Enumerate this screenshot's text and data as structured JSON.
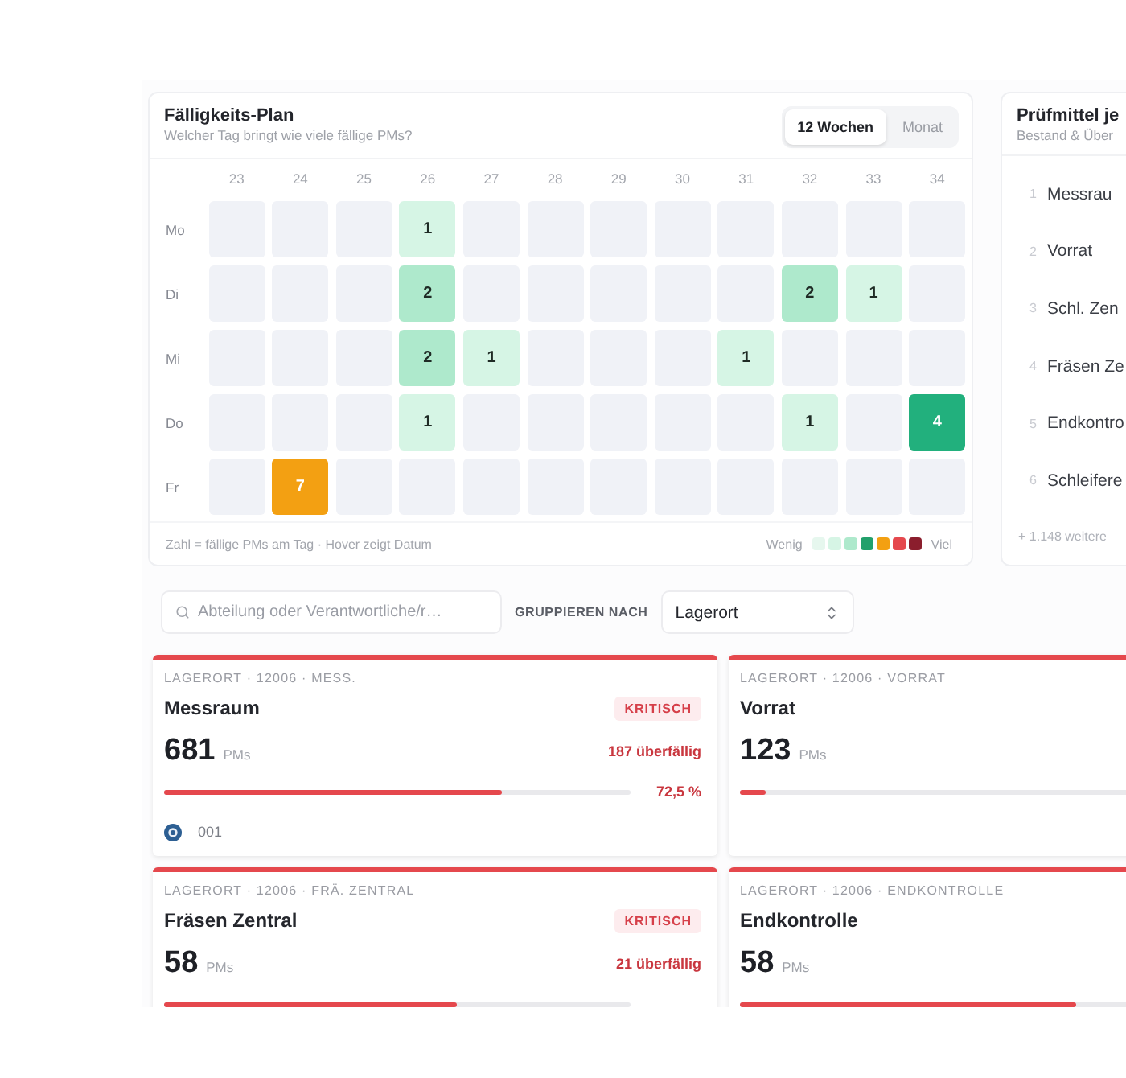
{
  "due_plan": {
    "title": "Fälligkeits-Plan",
    "subtitle": "Welcher Tag bringt wie viele fällige PMs?",
    "range_tabs": [
      {
        "label": "12 Wochen",
        "selected": true
      },
      {
        "label": "Monat",
        "selected": false
      }
    ],
    "weeks": [
      "23",
      "24",
      "25",
      "26",
      "27",
      "28",
      "29",
      "30",
      "31",
      "32",
      "33",
      "34"
    ],
    "rows": [
      {
        "day": "Mo",
        "cells": [
          null,
          null,
          null,
          {
            "count": "1",
            "color": "#d6f5e5"
          },
          null,
          null,
          null,
          null,
          null,
          null,
          null,
          null
        ]
      },
      {
        "day": "Di",
        "cells": [
          null,
          null,
          null,
          {
            "count": "2",
            "color": "#aee9cc"
          },
          null,
          null,
          null,
          null,
          null,
          {
            "count": "2",
            "color": "#aee9cc"
          },
          {
            "count": "1",
            "color": "#d6f5e5"
          },
          null
        ]
      },
      {
        "day": "Mi",
        "cells": [
          null,
          null,
          null,
          {
            "count": "2",
            "color": "#aee9cc"
          },
          {
            "count": "1",
            "color": "#d6f5e5"
          },
          null,
          null,
          null,
          {
            "count": "1",
            "color": "#d6f5e5"
          },
          null,
          null,
          null
        ]
      },
      {
        "day": "Do",
        "cells": [
          null,
          null,
          null,
          {
            "count": "1",
            "color": "#d6f5e5"
          },
          null,
          null,
          null,
          null,
          null,
          {
            "count": "1",
            "color": "#d6f5e5"
          },
          null,
          {
            "count": "4",
            "color": "#22b07d"
          }
        ]
      },
      {
        "day": "Fr",
        "cells": [
          null,
          {
            "count": "7",
            "color": "#f3a012"
          },
          null,
          null,
          null,
          null,
          null,
          null,
          null,
          null,
          null,
          null
        ]
      }
    ],
    "footnote": "Zahl = fällige PMs am Tag · Hover zeigt Datum",
    "legend": {
      "low": "Wenig",
      "high": "Viel",
      "swatches": [
        {
          "color": "#e6f7ee"
        },
        {
          "color": "#d6f5e5"
        },
        {
          "color": "#aee9cc"
        },
        {
          "color": "#22a06b"
        },
        {
          "color": "#f3a012"
        },
        {
          "color": "#e5484d"
        },
        {
          "color": "#8b1e2d"
        }
      ]
    }
  },
  "ranking_panel": {
    "title": "Prüfmittel je",
    "subtitle": "Bestand & Über",
    "items": [
      {
        "rank": "1",
        "name": "Messrau"
      },
      {
        "rank": "2",
        "name": "Vorrat"
      },
      {
        "rank": "3",
        "name": "Schl. Zen"
      },
      {
        "rank": "4",
        "name": "Fräsen Ze"
      },
      {
        "rank": "5",
        "name": "Endkontro"
      },
      {
        "rank": "6",
        "name": "Schleifere"
      }
    ],
    "more": "+ 1.148 weitere"
  },
  "filters": {
    "search": {
      "placeholder": "Abteilung oder Verantwortliche/r…"
    },
    "group_label": "GRUPPIEREN NACH",
    "group_select": {
      "value": "Lagerort"
    }
  },
  "cards": [
    {
      "kicker": "LAGERORT · 12006 · MESS.",
      "title": "Messraum",
      "badge": "KRITISCH",
      "count": "681",
      "unit": "PMs",
      "overdue": "187 überfällig",
      "level": 0.725,
      "percent": "72,5 %",
      "owner": "001"
    },
    {
      "kicker": "LAGERORT · 12006 · VORRAT",
      "title": "Vorrat",
      "count": "123",
      "unit": "PMs",
      "level": 0.055
    },
    {
      "kicker": "LAGERORT · 12006 · FRÄ. ZENTRAL",
      "title": "Fräsen Zentral",
      "badge": "KRITISCH",
      "count": "58",
      "unit": "PMs",
      "overdue": "21 überfällig",
      "level": 0.628
    },
    {
      "kicker": "LAGERORT · 12006 · ENDKONTROLLE",
      "title": "Endkontrolle",
      "count": "58",
      "unit": "PMs",
      "level": 0.72
    }
  ]
}
